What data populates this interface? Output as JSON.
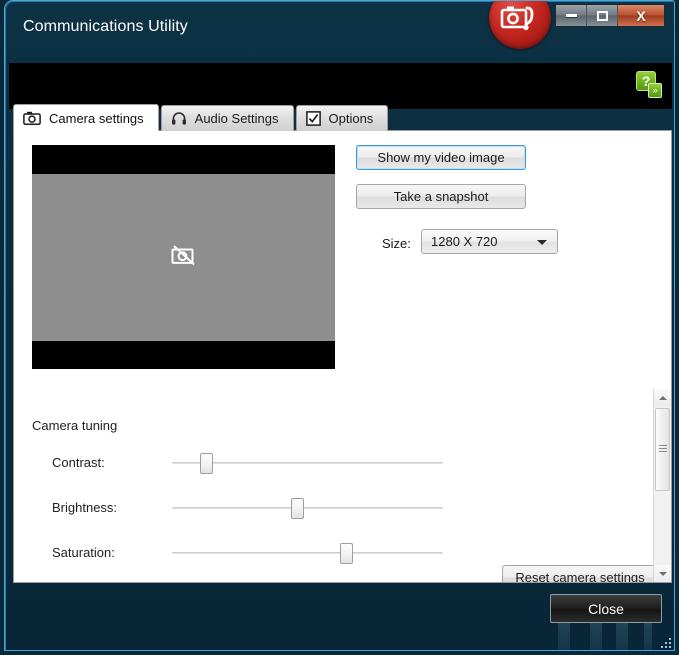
{
  "window": {
    "title": "Communications Utility",
    "logo_icon": "camera-phone-logo-icon",
    "controls": {
      "minimize_label": "–",
      "maximize_label": "□",
      "close_label": "X"
    }
  },
  "header": {
    "help_icon": "help-question-icon",
    "help_label": "?",
    "help_sub_label": "»"
  },
  "tabs": [
    {
      "label": "Camera settings",
      "icon": "camera-icon",
      "active": true
    },
    {
      "label": "Audio Settings",
      "icon": "headset-icon",
      "active": false
    },
    {
      "label": "Options",
      "icon": "checkbox-checked-icon",
      "active": false
    }
  ],
  "camera_panel": {
    "preview": {
      "icon": "camera-disabled-icon",
      "state": "no-video"
    },
    "show_video_button": "Show my video image",
    "snapshot_button": "Take a snapshot",
    "size_label": "Size:",
    "size_value": "1280 X 720",
    "size_options": [
      "1280 X 720"
    ],
    "dropdown_icon": "chevron-down-icon"
  },
  "camera_tuning": {
    "section_title": "Camera tuning",
    "sliders": [
      {
        "label": "Contrast:",
        "value_percent": 11
      },
      {
        "label": "Brightness:",
        "value_percent": 46
      },
      {
        "label": "Saturation:",
        "value_percent": 65
      }
    ],
    "reset_button": "Reset camera settings"
  },
  "scrollbar": {
    "up_icon": "scroll-up-arrow-icon",
    "down_icon": "scroll-down-arrow-icon",
    "thumb": "scrollbar-thumb"
  },
  "footer": {
    "close_button": "Close"
  },
  "colors": {
    "window_chrome": "#0b2838",
    "accent_border": "#49a8d8",
    "logo_red": "#c52720",
    "help_green": "#6fb122",
    "focus_blue": "#3c9ad8",
    "close_button_bg": "#1d1d1d"
  }
}
